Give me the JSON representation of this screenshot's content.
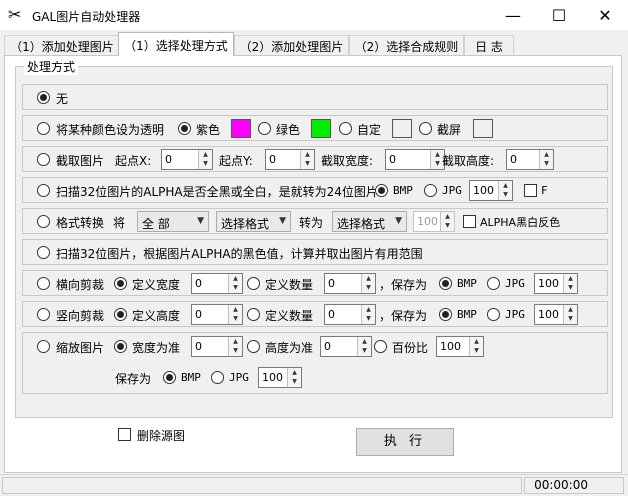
{
  "window": {
    "title": "GAL图片自动处理器",
    "app_icon": "scissors-icon",
    "controls": {
      "minimize": "—",
      "maximize": "☐",
      "close": "✕"
    }
  },
  "tabs": [
    {
      "label": "（1）添加处理图片",
      "active": false
    },
    {
      "label": "（1）选择处理方式",
      "active": true
    },
    {
      "label": "（2）添加处理图片",
      "active": false
    },
    {
      "label": "（2）选择合成规则",
      "active": false
    },
    {
      "label": "日 志",
      "active": false
    }
  ],
  "group_title": "处理方式",
  "rows": {
    "none": {
      "label": "无"
    },
    "transparent": {
      "label": "将某种颜色设为透明",
      "purple": "紫色",
      "green": "绿色",
      "custom": "自定",
      "screenshot": "截屏",
      "purple_color": "#ff00ff",
      "green_color": "#00ee00"
    },
    "crop": {
      "label": "截取图片",
      "start_x_label": "起点X:",
      "start_x": "0",
      "start_y_label": "起点Y:",
      "start_y": "0",
      "width_label": "截取宽度:",
      "width": "0",
      "height_label": "截取高度:",
      "height": "0"
    },
    "alpha_scan": {
      "label": "扫描32位图片的ALPHA是否全黑或全白，是就转为24位图片",
      "bmp": "BMP",
      "jpg": "JPG",
      "quality": "100",
      "f_label": "F"
    },
    "format": {
      "label": "格式转换",
      "from_label": "将",
      "from_value": "全 部",
      "select1": "选择格式",
      "to_label": "转为",
      "select2": "选择格式",
      "quality": "100",
      "invert_label": "ALPHA黑白反色"
    },
    "alpha_range": {
      "label": "扫描32位图片，根据图片ALPHA的黑色值，计算并取出图片有用范围"
    },
    "hcut": {
      "label": "横向剪裁",
      "def_width": "定义宽度",
      "width_val": "0",
      "def_count": "定义数量",
      "count_val": "0",
      "save_as": "，保存为",
      "bmp": "BMP",
      "jpg": "JPG",
      "quality": "100"
    },
    "vcut": {
      "label": "竖向剪裁",
      "def_height": "定义高度",
      "height_val": "0",
      "def_count": "定义数量",
      "count_val": "0",
      "save_as": "，保存为",
      "bmp": "BMP",
      "jpg": "JPG",
      "quality": "100"
    },
    "scale": {
      "label": "缩放图片",
      "by_width": "宽度为准",
      "width_val": "0",
      "by_height": "高度为准",
      "height_val": "0",
      "percent": "百份比",
      "percent_val": "100",
      "save_as": "保存为",
      "bmp": "BMP",
      "jpg": "JPG",
      "quality": "100"
    }
  },
  "delete_source": "删除源图",
  "execute": "执 行",
  "status": {
    "time": "00:00:00"
  }
}
